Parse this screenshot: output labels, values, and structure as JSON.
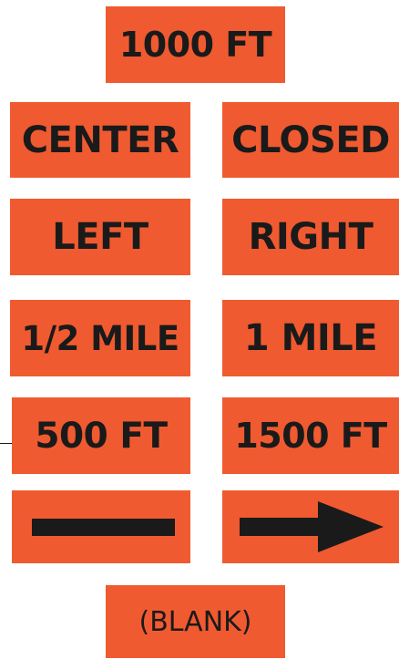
{
  "colors": {
    "sign_background": "#f05a30",
    "legend": "#1a1a1a"
  },
  "signs": {
    "top": "1000 FT",
    "center": "CENTER",
    "closed": "CLOSED",
    "left": "LEFT",
    "right": "RIGHT",
    "half_mile": "1/2 MILE",
    "one_mile": "1 MILE",
    "ft_500": "500 FT",
    "ft_1500": "1500 FT",
    "blank": "(BLANK)"
  },
  "icons": {
    "bar": "horizontal-bar-icon",
    "arrow": "right-arrow-icon"
  }
}
